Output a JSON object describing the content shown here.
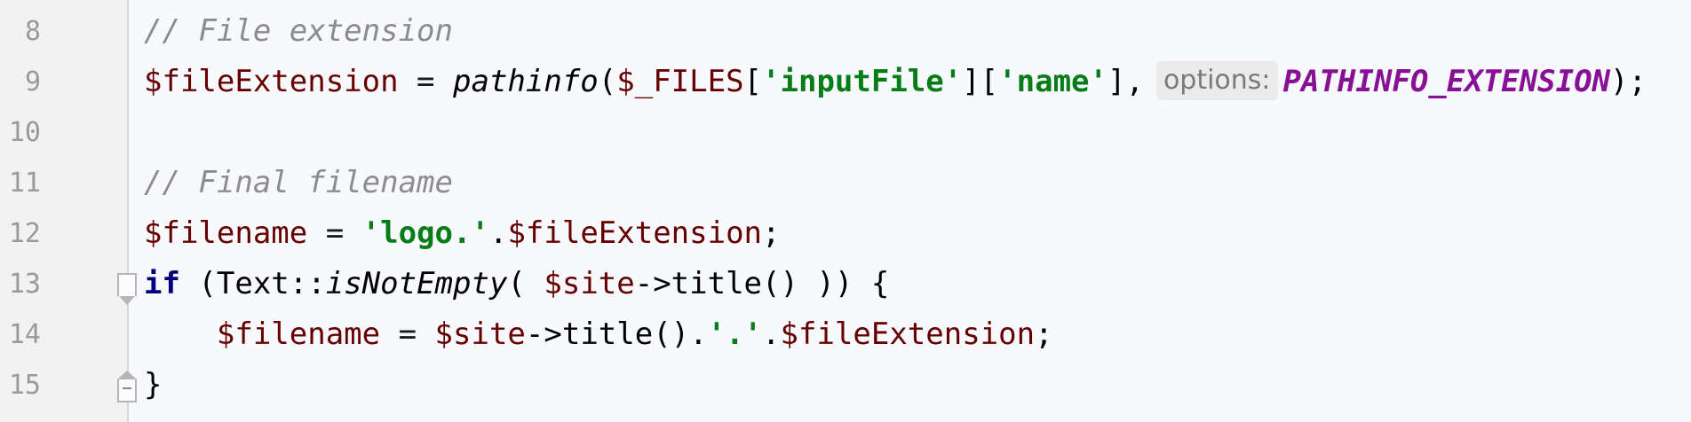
{
  "line_numbers": [
    "8",
    "9",
    "10",
    "11",
    "12",
    "13",
    "14",
    "15"
  ],
  "lines": {
    "l8": {
      "comment": "// File extension"
    },
    "l9": {
      "var": "$fileExtension",
      "assign": " = ",
      "func": "pathinfo",
      "open": "(",
      "files": "$_FILES",
      "br1": "[",
      "str1": "'inputFile'",
      "br2": "][",
      "str2": "'name'",
      "br3": "],",
      "hint": "options:",
      "const": "PATHINFO_EXTENSION",
      "close": ");"
    },
    "l11": {
      "comment": "// Final filename"
    },
    "l12": {
      "var": "$filename",
      "assign": " = ",
      "str": "'logo.'",
      "dot": ".",
      "var2": "$fileExtension",
      "semi": ";"
    },
    "l13": {
      "kw": "if",
      "open": " (Text::",
      "func": "isNotEmpty",
      "paren": "( ",
      "var": "$site",
      "rest": "->title() )) {"
    },
    "l14": {
      "indent": "    ",
      "var": "$filename",
      "assign": " = ",
      "var2": "$site",
      "mid": "->title().",
      "str": "'.'",
      "dot": ".",
      "var3": "$fileExtension",
      "semi": ";"
    },
    "l15": {
      "brace": "}"
    }
  },
  "colors": {
    "background": "#f7f9fc",
    "gutter": "#f2f2f2",
    "comment": "#8c8c8c",
    "variable": "#660000",
    "string": "#067d17",
    "keyword": "#00007f",
    "constant": "#871094"
  },
  "icons": [
    "fold-open-icon",
    "fold-close-icon"
  ]
}
